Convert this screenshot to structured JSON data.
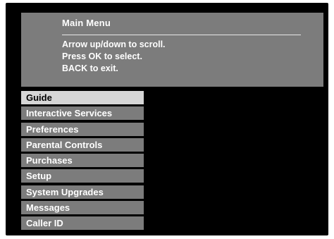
{
  "menu": {
    "title": "Main Menu",
    "instructions": [
      "Arrow up/down to scroll.",
      "Press OK to select.",
      "BACK to exit."
    ],
    "selected_index": 0,
    "items": [
      {
        "label": "Guide"
      },
      {
        "label": "Interactive Services"
      },
      {
        "label": "Preferences"
      },
      {
        "label": "Parental Controls"
      },
      {
        "label": "Purchases"
      },
      {
        "label": "Setup"
      },
      {
        "label": "System Upgrades"
      },
      {
        "label": "Messages"
      },
      {
        "label": "Caller ID"
      }
    ]
  },
  "colors": {
    "background": "#000000",
    "panel": "#7c7c7c",
    "selected": "#d6d6d6",
    "text": "#ffffff",
    "selected_text": "#000000"
  }
}
